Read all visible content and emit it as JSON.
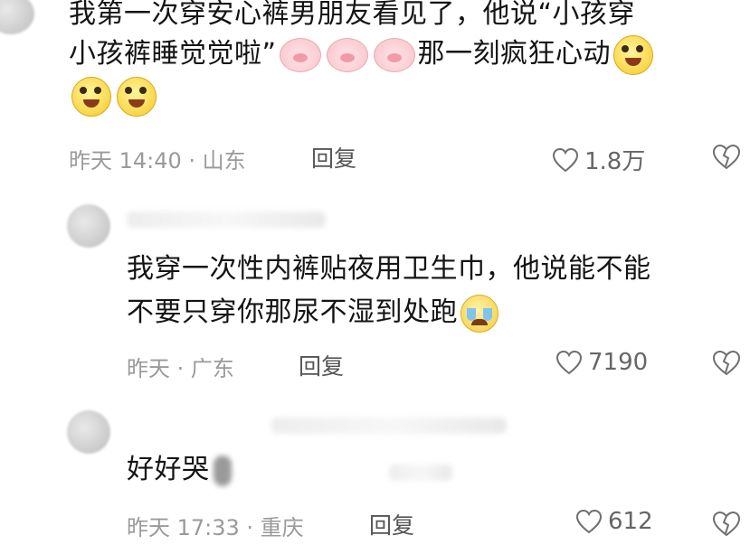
{
  "comments": [
    {
      "text_line1": "我第一次穿安心裤男朋友看见了，他说“小孩穿",
      "text_line2": "小孩裤睡觉觉啦”",
      "text_line2b": "那一刻疯狂心动",
      "meta": "昨天 14:40 · 山东",
      "reply_label": "回复",
      "like_count": "1.8万"
    },
    {
      "text_line1": "我穿一次性内裤贴夜用卫生巾，他说能不能",
      "text_line2": "不要只穿你那尿不湿到处跑",
      "meta": "昨天 · 广东",
      "reply_label": "回复",
      "like_count": "7190"
    },
    {
      "text_line1": "好好哭",
      "meta": "昨天 17:33 · 重庆",
      "reply_label": "回复",
      "like_count": "612"
    }
  ],
  "icons": {
    "like": "heart-outline-icon",
    "dislike": "broken-heart-icon",
    "emoji_pig": "pig-face-emoji",
    "emoji_happy": "happy-face-emoji",
    "emoji_cry": "crying-laugh-emoji"
  },
  "colors": {
    "meta": "#9a9a9a",
    "text": "#141414",
    "icon": "#6f6f6f"
  }
}
